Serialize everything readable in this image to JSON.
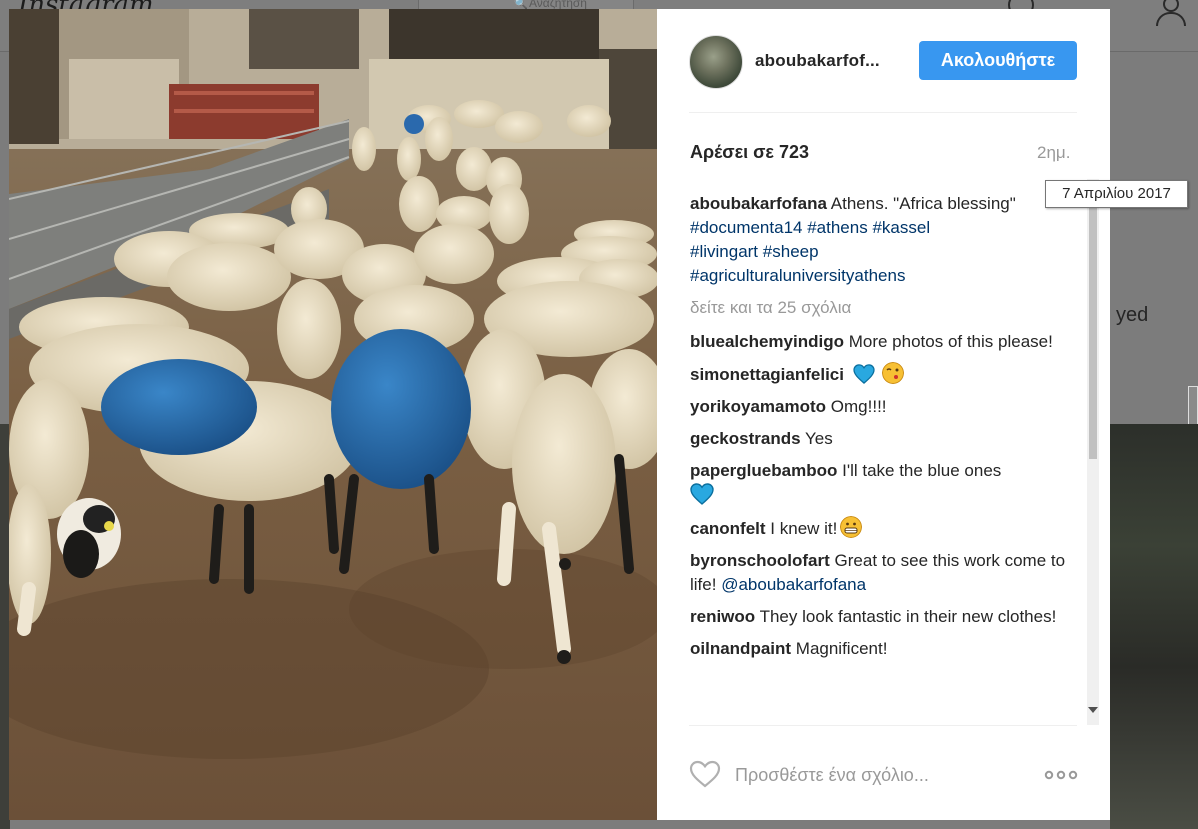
{
  "background": {
    "logo": "Instagram",
    "search_placeholder": "Αναζήτηση",
    "partial_text": "yed"
  },
  "post": {
    "author": "aboubakarfof...",
    "follow_label": "Ακολουθήστε",
    "likes_label": "Αρέσει σε 723",
    "time_ago": "2ημ.",
    "date_tooltip": "7 Απριλίου 2017",
    "caption": {
      "username": "aboubakarfofana",
      "text": "Athens. \"Africa blessing\"",
      "hashtags": [
        "#documenta14",
        "#athens",
        "#kassel",
        "#livingart",
        "#sheep",
        "#agriculturaluniversityathens"
      ]
    },
    "view_all_comments": "δείτε και τα 25 σχόλια",
    "comments": [
      {
        "username": "bluealchemyindigo",
        "text": "More photos of this please!"
      },
      {
        "username": "simonettagianfelici",
        "text": ""
      },
      {
        "username": "yorikoyamamoto",
        "text": "Omg!!!!"
      },
      {
        "username": "geckostrands",
        "text": "Yes"
      },
      {
        "username": "paperglueb​amboo",
        "text": "I'll take the blue ones"
      },
      {
        "username": "canonfelt",
        "text": "I knew it!"
      },
      {
        "username": "byronschoolofart",
        "text": "Great to see this work come to life!",
        "mention": "@aboubakarfofana"
      },
      {
        "username": "reniwoo",
        "text": "They look fantastic in their new clothes!"
      },
      {
        "username": "oilnandpaint",
        "text": "Magnificent!"
      }
    ],
    "add_comment_placeholder": "Προσθέστε ένα σχόλιο..."
  },
  "colors": {
    "accent": "#3897f0",
    "hashtag": "#003569",
    "muted": "#999999",
    "emoji_heart": "#29a8e0"
  },
  "icons": [
    "heart-icon",
    "more-options-icon",
    "blue-heart-icon",
    "winking-kiss-emoji",
    "grinning-emoji",
    "search-icon",
    "compass-icon",
    "profile-icon"
  ]
}
